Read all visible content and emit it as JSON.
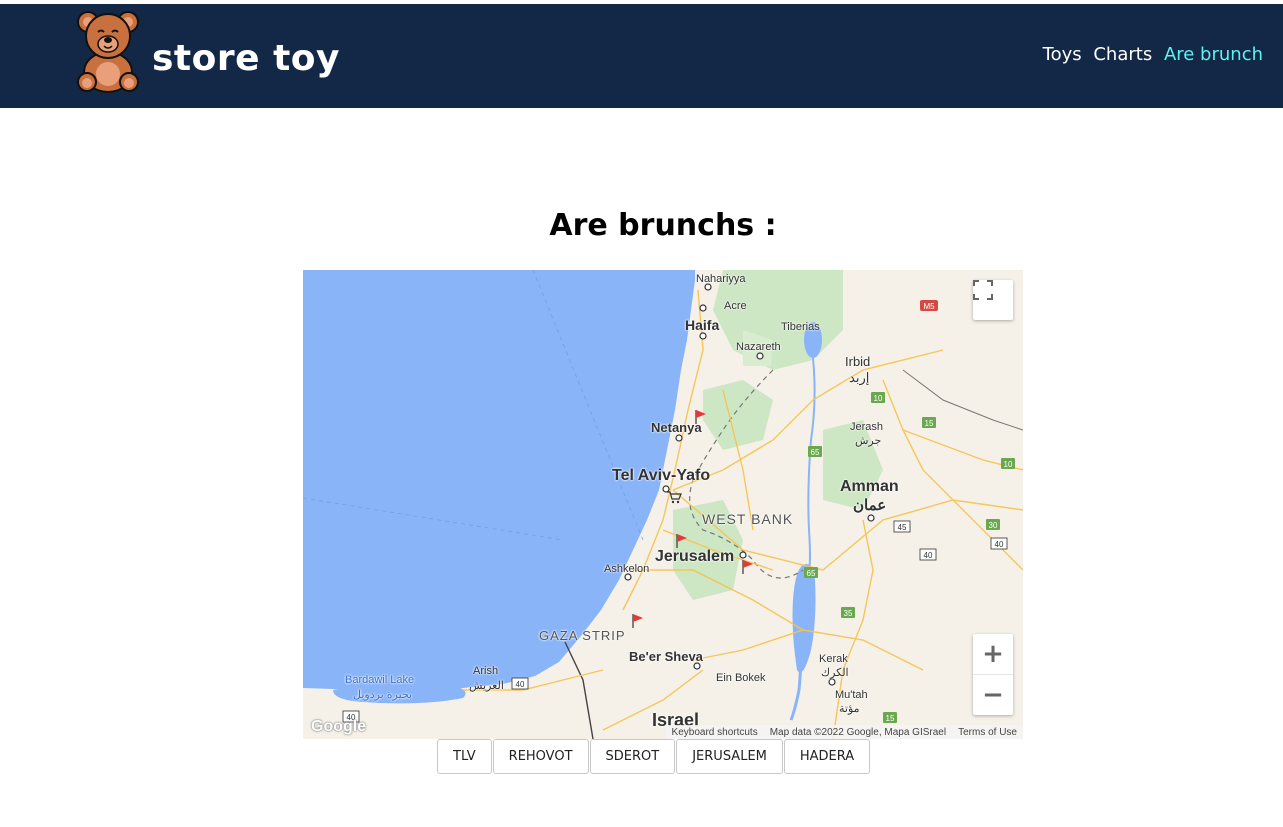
{
  "header": {
    "brand": "store toy",
    "nav": {
      "item1": "Toys",
      "item2": "Charts",
      "item3": "Are brunch"
    }
  },
  "main": {
    "title": "Are brunchs :"
  },
  "map": {
    "places": {
      "nahariyya": "Nahariyya",
      "acre": "Acre",
      "haifa": "Haifa",
      "tiberias": "Tiberias",
      "nazareth": "Nazareth",
      "irbid": "Irbid",
      "irbid_ar": "إربد",
      "netanya": "Netanya",
      "jerash": "Jerash",
      "jerash_ar": "جرش",
      "telaviv": "Tel Aviv-Yafo",
      "amman": "Amman",
      "amman_ar": "عمان",
      "westbank": "WEST BANK",
      "jerusalem": "Jerusalem",
      "ashkelon": "Ashkelon",
      "gaza": "GAZA STRIP",
      "beersheva": "Be'er Sheva",
      "kerak": "Kerak",
      "kerak_ar": "الكرك",
      "arish": "Arish",
      "arish_ar": "العريش",
      "bardawil": "Bardawil Lake",
      "bardawil_ar": "بحيرة بردويل",
      "einbokek": "Ein Bokek",
      "mutah": "Mu'tah",
      "mutah_ar": "مؤتة",
      "israel": "Israel"
    },
    "road_shields": [
      "M5",
      "10",
      "15",
      "10",
      "65",
      "45",
      "30",
      "40",
      "40",
      "65",
      "35",
      "15",
      "40",
      "40"
    ],
    "controls": {
      "zoom_in": "+",
      "zoom_out": "−"
    },
    "attribution": {
      "shortcuts": "Keyboard shortcuts",
      "data": "Map data ©2022 Google, Mapa GISrael",
      "terms": "Terms of Use",
      "logo": "Google"
    },
    "colors": {
      "sea": "#8ab4f8",
      "land": "#f5f1e8",
      "park": "#cde6c4",
      "road": "#f6c451",
      "marker": "#e53935"
    }
  },
  "branches": [
    "TLV",
    "REHOVOT",
    "SDEROT",
    "JERUSALEM",
    "HADERA"
  ]
}
